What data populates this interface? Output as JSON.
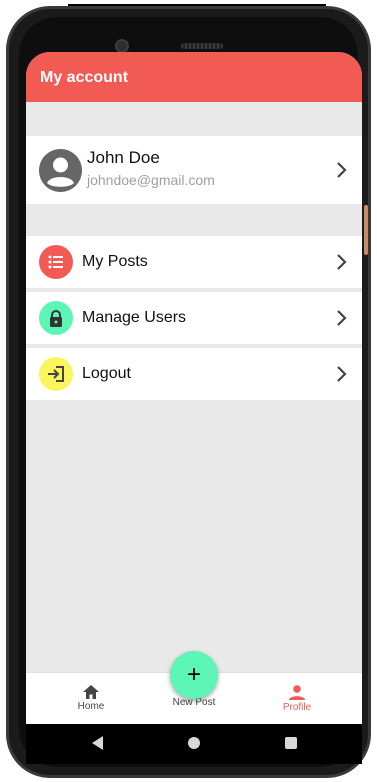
{
  "header": {
    "title": "My account"
  },
  "account": {
    "name": "John Doe",
    "email": "johndoe@gmail.com"
  },
  "menu": [
    {
      "label": "My Posts",
      "icon": "list-icon",
      "color": "#f15b53"
    },
    {
      "label": "Manage Users",
      "icon": "lock-icon",
      "color": "#5cf5b6"
    },
    {
      "label": "Logout",
      "icon": "logout-icon",
      "color": "#f9f55a"
    }
  ],
  "tabs": {
    "home": "Home",
    "new_post": "New Post",
    "profile": "Profile",
    "fab_symbol": "+"
  },
  "colors": {
    "accent": "#f15b53",
    "fab": "#5cf5b6"
  }
}
